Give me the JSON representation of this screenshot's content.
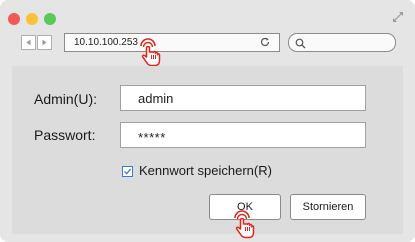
{
  "browser": {
    "url": "10.10.100.253",
    "search_placeholder": ""
  },
  "login": {
    "username_label": "Admin(U):",
    "username_value": "admin",
    "password_label": "Passwort:",
    "password_value": "*****",
    "remember_label": "Kennwort speichern(R)",
    "remember_checked": true,
    "ok_label": "OK",
    "cancel_label": "Stornieren"
  },
  "colors": {
    "close": "#ee5a56",
    "minimize": "#f8c23c",
    "maximize": "#5cc85a",
    "pointer_accent": "#e0261c",
    "checkbox_accent": "#3a7bd5"
  },
  "icons": {
    "back": "triangle-left-icon",
    "forward": "triangle-right-icon",
    "reload": "reload-icon",
    "search": "search-icon",
    "resize": "expand-icon",
    "pointer": "hand-pointer-icon"
  }
}
